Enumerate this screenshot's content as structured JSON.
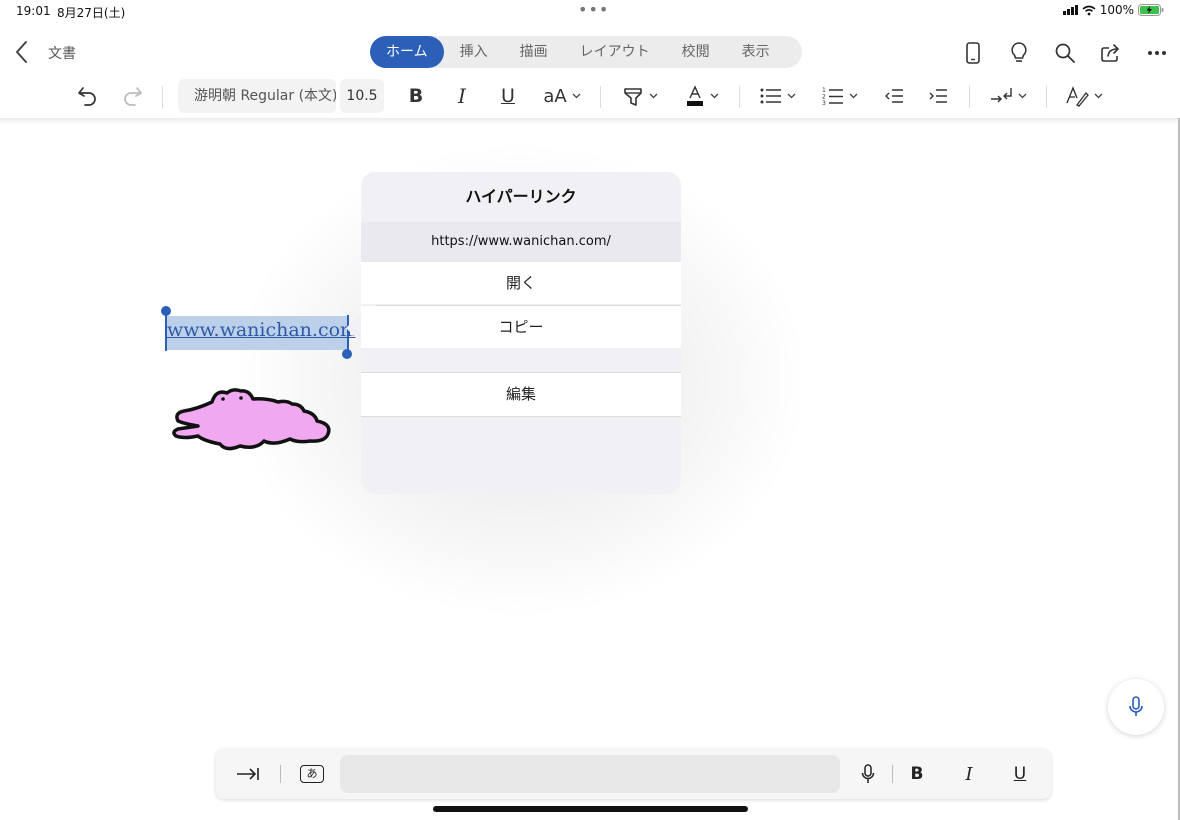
{
  "status_bar": {
    "time": "19:01",
    "date": "8月27日(土)",
    "battery": "100%"
  },
  "header": {
    "doc_title": "文書",
    "tabs": [
      {
        "label": "ホーム",
        "active": true
      },
      {
        "label": "挿入",
        "active": false
      },
      {
        "label": "描画",
        "active": false
      },
      {
        "label": "レイアウト",
        "active": false
      },
      {
        "label": "校閲",
        "active": false
      },
      {
        "label": "表示",
        "active": false
      }
    ],
    "right_icons": [
      "phone-view-icon",
      "lightbulb-icon",
      "search-icon",
      "share-icon",
      "more-icon"
    ]
  },
  "ribbon": {
    "font_name": "游明朝 Regular (本文)",
    "font_size": "10.5",
    "bold": "B",
    "italic": "I",
    "underline": "U",
    "case": "aA",
    "icons": [
      "undo-icon",
      "redo-icon",
      "highlighter-icon",
      "font-color-icon",
      "bullet-list-icon",
      "numbered-list-icon",
      "decrease-indent-icon",
      "increase-indent-icon",
      "paragraph-mark-icon",
      "styles-icon"
    ],
    "font_color": "#111111"
  },
  "document": {
    "link_text": "www.wanichan.com",
    "link_color": "#2f5aa7"
  },
  "popover": {
    "title": "ハイパーリンク",
    "url": "https://www.wanichan.com/",
    "open_label": "開く",
    "copy_label": "コピー",
    "edit_label": "編集"
  },
  "keyboard_bar": {
    "bold": "B",
    "italic": "I",
    "underline": "U",
    "kana_label": "あ",
    "icons": [
      "tab-icon",
      "kana-keyboard-icon",
      "mic-icon"
    ]
  },
  "colors": {
    "accent": "#2b5fb8",
    "selection": "#bcd0ea",
    "crocodile": "#f0a8f0"
  }
}
